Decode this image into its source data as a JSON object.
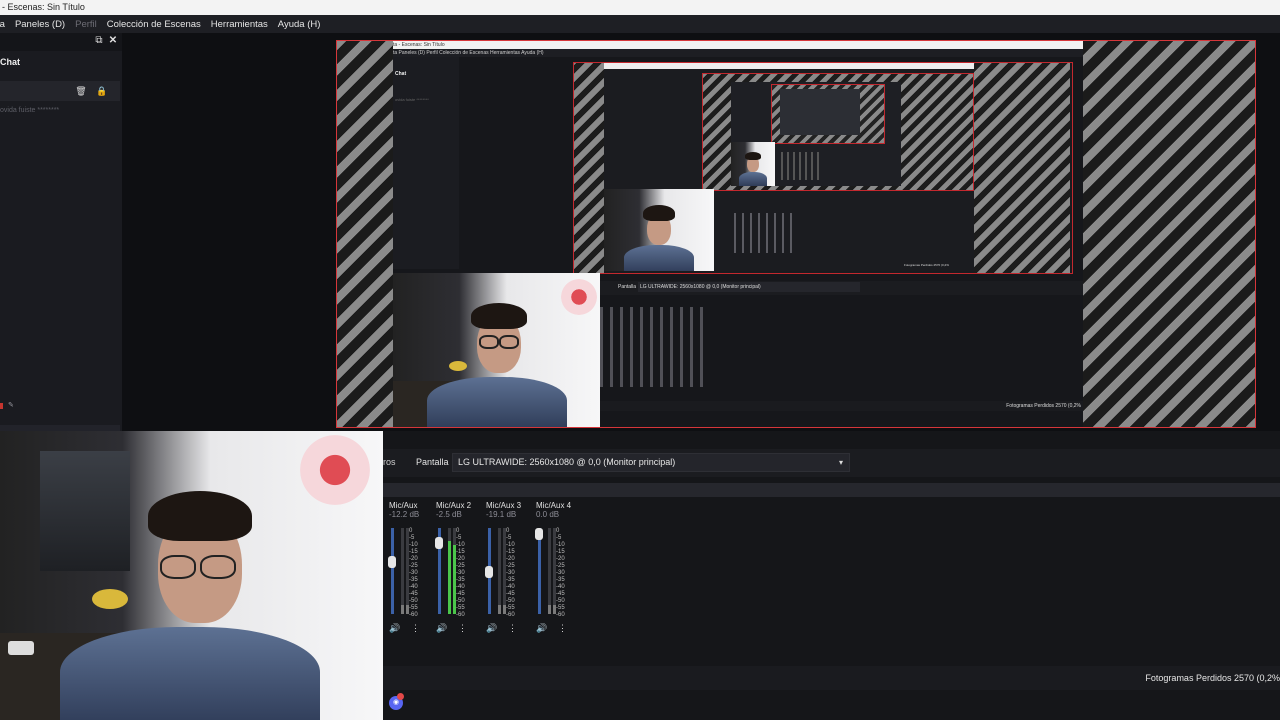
{
  "window": {
    "title": "ta - Escenas: Sin Título"
  },
  "menubar": {
    "items": [
      "Paneles (D)",
      "Perfil",
      "Colección de Escenas",
      "Herramientas",
      "Ayuda (H)"
    ],
    "leading_fragment": "ta"
  },
  "chat_dock": {
    "title": "Chat",
    "message_fragment": "ovida fuiste ********",
    "float_icon": "⧉",
    "close_icon": "✕",
    "trash_icon": "🗑",
    "lock_icon": "🔒",
    "pencil_icon": "✎"
  },
  "preview": {
    "mini_title": "ta - Escenas: Sin Título",
    "mini_menu": "ta   Paneles (D)   Perfil   Colección de Escenas   Herramientas   Ayuda (H)",
    "mini_chat": "Chat",
    "mini_msg": "ovida fuiste ********",
    "mini_pantalla": "Pantalla",
    "mini_source": "LG ULTRAWIDE: 2560x1080 @ 0,0 (Monitor principal)",
    "mini_status": "Fotogramas Perdidos 2570 (0,2%"
  },
  "sources_toolbar": {
    "filters_fragment": "ros",
    "display_label": "Pantalla",
    "display_value": "LG ULTRAWIDE: 2560x1080 @ 0,0 (Monitor principal)",
    "chevron_icon": "▾"
  },
  "mixer": {
    "scale": [
      "0",
      "-5",
      "-10",
      "-15",
      "-20",
      "-25",
      "-30",
      "-35",
      "-40",
      "-45",
      "-50",
      "-55",
      "-60"
    ],
    "channels": [
      {
        "name": "Mic/Aux",
        "db": "-12.2 dB",
        "level": 0.62,
        "muted": true,
        "icon": "🔊"
      },
      {
        "name": "Mic/Aux 2",
        "db": "-2.5 dB",
        "level": 0.88,
        "muted": false,
        "icon": "🔊"
      },
      {
        "name": "Mic/Aux 3",
        "db": "-19.1 dB",
        "level": 0.48,
        "muted": true,
        "icon": "🔊"
      },
      {
        "name": "Mic/Aux 4",
        "db": "0.0 dB",
        "level": 1.0,
        "muted": true,
        "icon": "🔊"
      }
    ],
    "menu_icon": "⋮"
  },
  "status": {
    "dropped_frames": "Fotogramas Perdidos 2570 (0,2%"
  },
  "taskbar": {
    "discord_icon": "discord-icon"
  },
  "colors": {
    "accent_red": "#d6363a",
    "fader_blue": "#3b61a8",
    "meter_green": "#4bc64b"
  }
}
